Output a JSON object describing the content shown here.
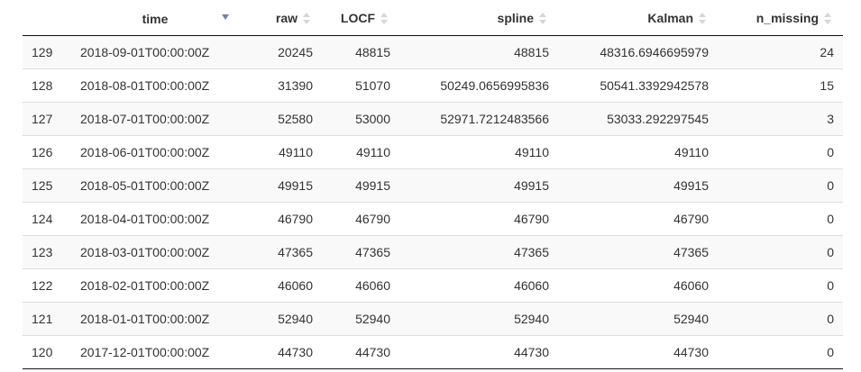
{
  "table": {
    "columns": [
      {
        "key": "idx",
        "label": ""
      },
      {
        "key": "time",
        "label": "time"
      },
      {
        "key": "raw",
        "label": "raw"
      },
      {
        "key": "locf",
        "label": "LOCF"
      },
      {
        "key": "spline",
        "label": "spline"
      },
      {
        "key": "kalman",
        "label": "Kalman"
      },
      {
        "key": "n_missing",
        "label": "n_missing"
      }
    ],
    "sort": {
      "column": "time",
      "direction": "descending"
    },
    "rows": [
      {
        "idx": "129",
        "time": "2018-09-01T00:00:00Z",
        "raw": "20245",
        "locf": "48815",
        "spline": "48815",
        "kalman": "48316.6946695979",
        "n_missing": "24"
      },
      {
        "idx": "128",
        "time": "2018-08-01T00:00:00Z",
        "raw": "31390",
        "locf": "51070",
        "spline": "50249.0656995836",
        "kalman": "50541.3392942578",
        "n_missing": "15"
      },
      {
        "idx": "127",
        "time": "2018-07-01T00:00:00Z",
        "raw": "52580",
        "locf": "53000",
        "spline": "52971.7212483566",
        "kalman": "53033.292297545",
        "n_missing": "3"
      },
      {
        "idx": "126",
        "time": "2018-06-01T00:00:00Z",
        "raw": "49110",
        "locf": "49110",
        "spline": "49110",
        "kalman": "49110",
        "n_missing": "0"
      },
      {
        "idx": "125",
        "time": "2018-05-01T00:00:00Z",
        "raw": "49915",
        "locf": "49915",
        "spline": "49915",
        "kalman": "49915",
        "n_missing": "0"
      },
      {
        "idx": "124",
        "time": "2018-04-01T00:00:00Z",
        "raw": "46790",
        "locf": "46790",
        "spline": "46790",
        "kalman": "46790",
        "n_missing": "0"
      },
      {
        "idx": "123",
        "time": "2018-03-01T00:00:00Z",
        "raw": "47365",
        "locf": "47365",
        "spline": "47365",
        "kalman": "47365",
        "n_missing": "0"
      },
      {
        "idx": "122",
        "time": "2018-02-01T00:00:00Z",
        "raw": "46060",
        "locf": "46060",
        "spline": "46060",
        "kalman": "46060",
        "n_missing": "0"
      },
      {
        "idx": "121",
        "time": "2018-01-01T00:00:00Z",
        "raw": "52940",
        "locf": "52940",
        "spline": "52940",
        "kalman": "52940",
        "n_missing": "0"
      },
      {
        "idx": "120",
        "time": "2017-12-01T00:00:00Z",
        "raw": "44730",
        "locf": "44730",
        "spline": "44730",
        "kalman": "44730",
        "n_missing": "0"
      }
    ]
  }
}
